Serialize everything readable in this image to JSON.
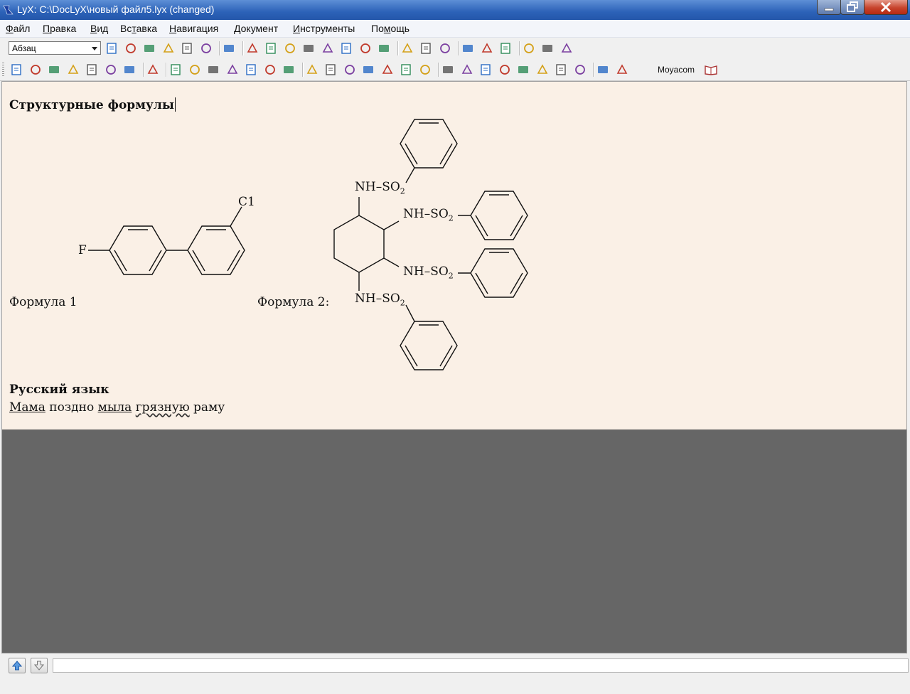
{
  "window": {
    "title": "LyX: C:\\DocLyX\\новый файл5.lyx (changed)",
    "colors": {
      "titlebar": "#2c62b8",
      "document_bg": "#faf0e6",
      "workspace_bg": "#666666",
      "close": "#c7432c"
    }
  },
  "menubar": {
    "items": [
      "Файл",
      "Правка",
      "Вид",
      "Вставка",
      "Навигация",
      "Документ",
      "Инструменты",
      "Помощь"
    ],
    "accelerators": [
      "Ф",
      "П",
      "В",
      "т",
      "Н",
      "Д",
      "И",
      "м"
    ]
  },
  "toolbar1": {
    "paragraph_style": "Абзац",
    "icons": [
      "new-document-icon",
      "open-document-icon",
      "open-recent-icon",
      "print-icon",
      "save-icon",
      "print-preview-icon",
      "spellcheck-icon",
      "undo-icon",
      "redo-icon",
      "cut-icon",
      "copy-icon",
      "paste-icon",
      "find-binoculars-icon",
      "find-replace-icon",
      "goto-icon",
      "emphasize-icon",
      "noun-icon",
      "text-style-icon",
      "math-sum-icon",
      "insert-graphics-icon",
      "insert-table-icon",
      "navigator-compass-icon",
      "math-panel-icon",
      "table-panel-icon"
    ]
  },
  "toolbar2": {
    "custom_label": "Moyacom",
    "icons": [
      "view-dvi-icon",
      "update-icon",
      "view-pdf-icon",
      "view-ps-icon",
      "view-html-icon",
      "view-master-icon",
      "update-master-icon",
      "insert-image-icon",
      "align-left-icon",
      "list-numbered-icon",
      "list-itemize-icon",
      "list-description-icon",
      "list-enumerate-icon",
      "depth-increase-icon",
      "depth-decrease-icon",
      "insert-float-figure-icon",
      "insert-float-table-icon",
      "insert-label-icon",
      "insert-ref-icon",
      "insert-bookmark-icon",
      "insert-box-icon",
      "insert-index-icon",
      "paragraph-left-icon",
      "paragraph-right-icon",
      "insert-note-icon",
      "insert-footnote-icon",
      "insert-hyperlink-icon",
      "insert-tex-icon",
      "insert-verbatim-icon",
      "insert-attachment-icon",
      "text-ab-icon",
      "paragraph-settings-icon",
      "moyacom-book-icon"
    ]
  },
  "document": {
    "heading1": "Структурные формулы",
    "formula1": {
      "caption": "Формула 1",
      "atoms": {
        "fluorine": "F",
        "chlorine": "C1"
      }
    },
    "formula2": {
      "caption": "Формула 2:",
      "groups": {
        "top": "NH–SO",
        "right_upper": "NH–SO",
        "right_lower": "NH–SO",
        "bottom": "NH–SO",
        "subscript": "2"
      }
    },
    "heading2": "Русский язык",
    "sentence": {
      "w1": "Мама",
      "w2": " поздно ",
      "w3": "мыла",
      "w4": " ",
      "w5": "грязную",
      "w6": " раму"
    }
  },
  "statusbar": {
    "buttons": [
      "arrow-up-icon",
      "arrow-down-icon"
    ],
    "command_value": ""
  }
}
